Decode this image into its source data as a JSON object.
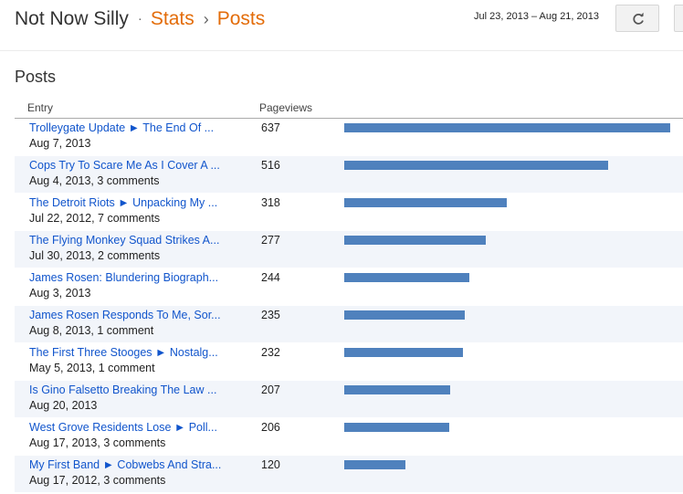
{
  "header": {
    "blog_name": "Not Now Silly",
    "dot": "·",
    "crumb_stats": "Stats",
    "sep": "›",
    "crumb_posts": "Posts",
    "date_range": "Jul 23, 2013 – Aug 21, 2013",
    "refresh_icon": "refresh-icon"
  },
  "section_title": "Posts",
  "table": {
    "col_entry": "Entry",
    "col_pageviews": "Pageviews",
    "max_pageviews": 637,
    "rows": [
      {
        "title": "Trolleygate Update ► The End Of ...",
        "meta": "Aug 7, 2013",
        "pageviews": "637",
        "value": 637
      },
      {
        "title": "Cops Try To Scare Me As I Cover A ...",
        "meta": "Aug 4, 2013, 3 comments",
        "pageviews": "516",
        "value": 516
      },
      {
        "title": "The Detroit Riots ► Unpacking My ...",
        "meta": "Jul 22, 2012, 7 comments",
        "pageviews": "318",
        "value": 318
      },
      {
        "title": "The Flying Monkey Squad Strikes A...",
        "meta": "Jul 30, 2013, 2 comments",
        "pageviews": "277",
        "value": 277
      },
      {
        "title": "James Rosen: Blundering Biograph...",
        "meta": "Aug 3, 2013",
        "pageviews": "244",
        "value": 244
      },
      {
        "title": "James Rosen Responds To Me, Sor...",
        "meta": "Aug 8, 2013, 1 comment",
        "pageviews": "235",
        "value": 235
      },
      {
        "title": "The First Three Stooges ► Nostalg...",
        "meta": "May 5, 2013, 1 comment",
        "pageviews": "232",
        "value": 232
      },
      {
        "title": "Is Gino Falsetto Breaking The Law ...",
        "meta": "Aug 20, 2013",
        "pageviews": "207",
        "value": 207
      },
      {
        "title": "West Grove Residents Lose ► Poll...",
        "meta": "Aug 17, 2013, 3 comments",
        "pageviews": "206",
        "value": 206
      },
      {
        "title": "My First Band ► Cobwebs And Stra...",
        "meta": "Aug 17, 2012, 3 comments",
        "pageviews": "120",
        "value": 120
      }
    ]
  },
  "colors": {
    "bar": "#4f81bd",
    "crumb": "#e36c09",
    "link": "#1155cc",
    "alt_row": "#f2f5fa"
  }
}
